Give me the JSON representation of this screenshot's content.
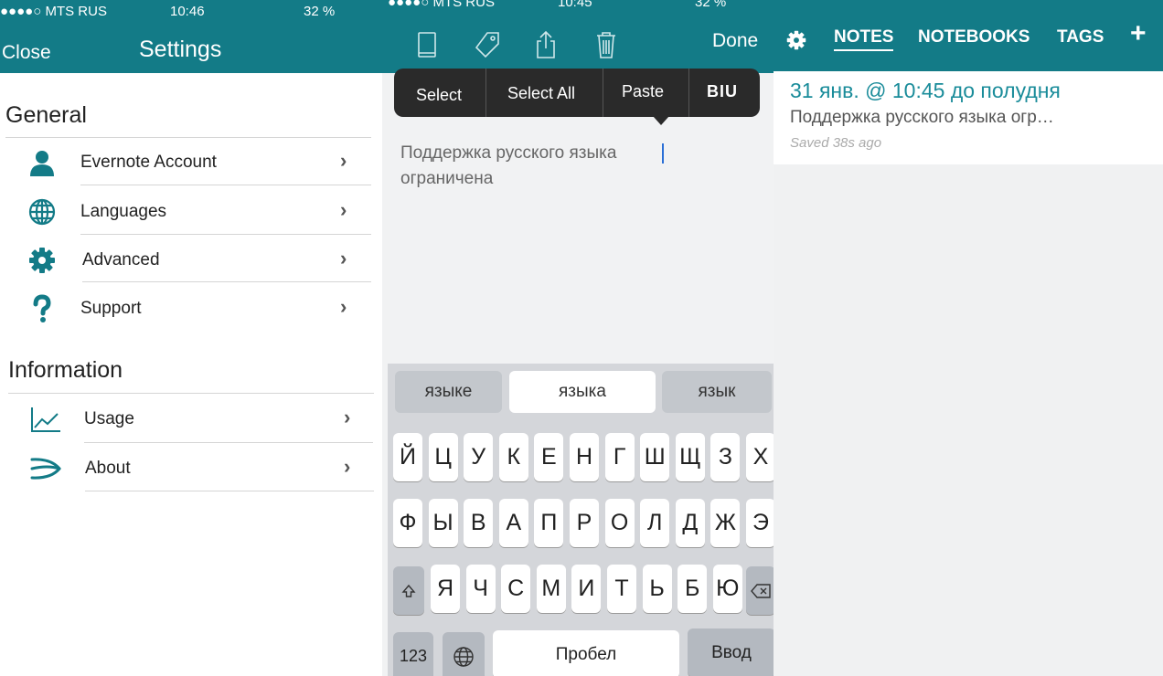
{
  "settings_screen": {
    "status": {
      "carrier": "●●●●○ MTS RUS",
      "time": "10:46",
      "battery": "32 %"
    },
    "close_label": "Close",
    "title": "Settings",
    "general_header": "General",
    "general_items": [
      {
        "label": "Evernote Account",
        "icon": "person-icon"
      },
      {
        "label": "Languages",
        "icon": "globe-icon"
      },
      {
        "label": "Advanced",
        "icon": "gear-icon"
      },
      {
        "label": "Support",
        "icon": "question-icon"
      }
    ],
    "information_header": "Information",
    "information_items": [
      {
        "label": "Usage",
        "icon": "chart-icon"
      },
      {
        "label": "About",
        "icon": "swiftkey-logo-icon"
      }
    ],
    "chevron": "›"
  },
  "editor_screen": {
    "status": {
      "carrier": "●●●●○ MTS RUS",
      "time": "10:45",
      "battery": "32 %"
    },
    "done_label": "Done",
    "menu": {
      "select": "Select",
      "select_all": "Select All",
      "paste": "Paste",
      "format": "BIU"
    },
    "note_text": "Поддержка русского языка ограничена",
    "suggestions": [
      "языке",
      "языка",
      "язык"
    ],
    "keyboard": {
      "row1": [
        "Й",
        "Ц",
        "У",
        "К",
        "Е",
        "Н",
        "Г",
        "Ш",
        "Щ",
        "З",
        "Х"
      ],
      "row2": [
        "Ф",
        "Ы",
        "В",
        "А",
        "П",
        "Р",
        "О",
        "Л",
        "Д",
        "Ж",
        "Э"
      ],
      "row3": [
        "Я",
        "Ч",
        "С",
        "М",
        "И",
        "Т",
        "Ь",
        "Б",
        "Ю"
      ],
      "numbers": "123",
      "space": "Пробел",
      "return": "Ввод"
    }
  },
  "notes_screen": {
    "tabs": [
      "NOTES",
      "NOTEBOOKS",
      "TAGS"
    ],
    "active_tab": "NOTES",
    "note": {
      "title": "31 янв. @ 10:45 до полудня",
      "snippet": "Поддержка русского языка огр…",
      "saved": "Saved 38s ago"
    }
  },
  "colors": {
    "accent": "#137b87",
    "note_title": "#1a8c9a"
  }
}
